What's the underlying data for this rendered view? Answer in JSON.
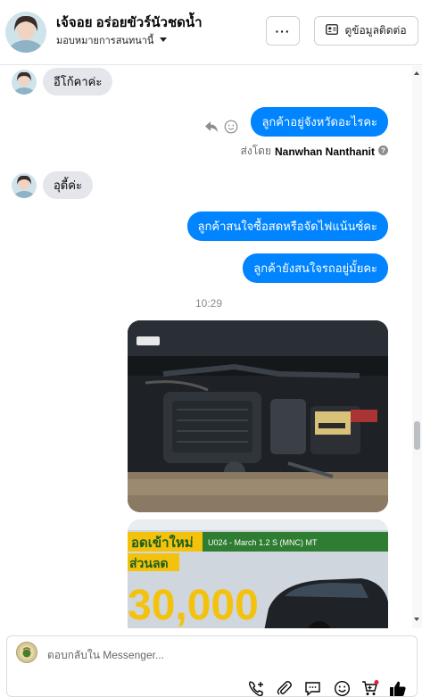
{
  "header": {
    "contact_name": "เจ้จอย อร่อยขัวร์นัวชดน้ำ",
    "assign_label": "มอบหมายการสนทนานี้",
    "more_label": "···",
    "contact_info_label": "ดูข้อมูลติดต่อ"
  },
  "messages": {
    "m1": "อีโก้คาค่ะ",
    "m2": "ลูกค้าอยู่จังหวัดอะไรคะ",
    "sent_by_prefix": "ส่งโดย",
    "sent_by_name": "Nanwhan Nanthanit",
    "m3": "อุดี้ค่ะ",
    "m4": "ลูกค้าสนใจซื้อสดหรือจัดไฟแน้นซ์คะ",
    "m5": "ลูกค้ายังสนใจรถอยู่มั้ยคะ",
    "timestamp": "10:29"
  },
  "photo2": {
    "banner_left": "อดเข้าใหม่",
    "banner_right": "U024 - March 1.2 S (MNC) MT",
    "discount_prefix": "ส่วนลด",
    "discount_amount": "30,000"
  },
  "composer": {
    "placeholder": "ตอบกลับใน Messenger..."
  },
  "colors": {
    "accent": "#0084ff",
    "incoming_bubble": "#e4e6eb",
    "banner_yellow": "#f4c20d",
    "banner_green": "#2e7d32"
  },
  "icons": [
    "chevron-down-icon",
    "contact-card-icon",
    "reply-icon",
    "smile-icon",
    "info-icon",
    "add-call-icon",
    "attach-icon",
    "saved-reply-icon",
    "emoji-icon",
    "cart-icon",
    "thumbs-up-icon"
  ]
}
